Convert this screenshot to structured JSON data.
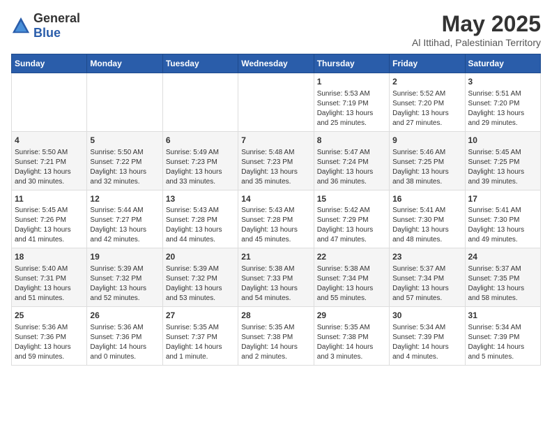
{
  "logo": {
    "text_general": "General",
    "text_blue": "Blue"
  },
  "title": "May 2025",
  "subtitle": "Al Ittihad, Palestinian Territory",
  "days_of_week": [
    "Sunday",
    "Monday",
    "Tuesday",
    "Wednesday",
    "Thursday",
    "Friday",
    "Saturday"
  ],
  "weeks": [
    [
      {
        "day": "",
        "info": ""
      },
      {
        "day": "",
        "info": ""
      },
      {
        "day": "",
        "info": ""
      },
      {
        "day": "",
        "info": ""
      },
      {
        "day": "1",
        "info": "Sunrise: 5:53 AM\nSunset: 7:19 PM\nDaylight: 13 hours\nand 25 minutes."
      },
      {
        "day": "2",
        "info": "Sunrise: 5:52 AM\nSunset: 7:20 PM\nDaylight: 13 hours\nand 27 minutes."
      },
      {
        "day": "3",
        "info": "Sunrise: 5:51 AM\nSunset: 7:20 PM\nDaylight: 13 hours\nand 29 minutes."
      }
    ],
    [
      {
        "day": "4",
        "info": "Sunrise: 5:50 AM\nSunset: 7:21 PM\nDaylight: 13 hours\nand 30 minutes."
      },
      {
        "day": "5",
        "info": "Sunrise: 5:50 AM\nSunset: 7:22 PM\nDaylight: 13 hours\nand 32 minutes."
      },
      {
        "day": "6",
        "info": "Sunrise: 5:49 AM\nSunset: 7:23 PM\nDaylight: 13 hours\nand 33 minutes."
      },
      {
        "day": "7",
        "info": "Sunrise: 5:48 AM\nSunset: 7:23 PM\nDaylight: 13 hours\nand 35 minutes."
      },
      {
        "day": "8",
        "info": "Sunrise: 5:47 AM\nSunset: 7:24 PM\nDaylight: 13 hours\nand 36 minutes."
      },
      {
        "day": "9",
        "info": "Sunrise: 5:46 AM\nSunset: 7:25 PM\nDaylight: 13 hours\nand 38 minutes."
      },
      {
        "day": "10",
        "info": "Sunrise: 5:45 AM\nSunset: 7:25 PM\nDaylight: 13 hours\nand 39 minutes."
      }
    ],
    [
      {
        "day": "11",
        "info": "Sunrise: 5:45 AM\nSunset: 7:26 PM\nDaylight: 13 hours\nand 41 minutes."
      },
      {
        "day": "12",
        "info": "Sunrise: 5:44 AM\nSunset: 7:27 PM\nDaylight: 13 hours\nand 42 minutes."
      },
      {
        "day": "13",
        "info": "Sunrise: 5:43 AM\nSunset: 7:28 PM\nDaylight: 13 hours\nand 44 minutes."
      },
      {
        "day": "14",
        "info": "Sunrise: 5:43 AM\nSunset: 7:28 PM\nDaylight: 13 hours\nand 45 minutes."
      },
      {
        "day": "15",
        "info": "Sunrise: 5:42 AM\nSunset: 7:29 PM\nDaylight: 13 hours\nand 47 minutes."
      },
      {
        "day": "16",
        "info": "Sunrise: 5:41 AM\nSunset: 7:30 PM\nDaylight: 13 hours\nand 48 minutes."
      },
      {
        "day": "17",
        "info": "Sunrise: 5:41 AM\nSunset: 7:30 PM\nDaylight: 13 hours\nand 49 minutes."
      }
    ],
    [
      {
        "day": "18",
        "info": "Sunrise: 5:40 AM\nSunset: 7:31 PM\nDaylight: 13 hours\nand 51 minutes."
      },
      {
        "day": "19",
        "info": "Sunrise: 5:39 AM\nSunset: 7:32 PM\nDaylight: 13 hours\nand 52 minutes."
      },
      {
        "day": "20",
        "info": "Sunrise: 5:39 AM\nSunset: 7:32 PM\nDaylight: 13 hours\nand 53 minutes."
      },
      {
        "day": "21",
        "info": "Sunrise: 5:38 AM\nSunset: 7:33 PM\nDaylight: 13 hours\nand 54 minutes."
      },
      {
        "day": "22",
        "info": "Sunrise: 5:38 AM\nSunset: 7:34 PM\nDaylight: 13 hours\nand 55 minutes."
      },
      {
        "day": "23",
        "info": "Sunrise: 5:37 AM\nSunset: 7:34 PM\nDaylight: 13 hours\nand 57 minutes."
      },
      {
        "day": "24",
        "info": "Sunrise: 5:37 AM\nSunset: 7:35 PM\nDaylight: 13 hours\nand 58 minutes."
      }
    ],
    [
      {
        "day": "25",
        "info": "Sunrise: 5:36 AM\nSunset: 7:36 PM\nDaylight: 13 hours\nand 59 minutes."
      },
      {
        "day": "26",
        "info": "Sunrise: 5:36 AM\nSunset: 7:36 PM\nDaylight: 14 hours\nand 0 minutes."
      },
      {
        "day": "27",
        "info": "Sunrise: 5:35 AM\nSunset: 7:37 PM\nDaylight: 14 hours\nand 1 minute."
      },
      {
        "day": "28",
        "info": "Sunrise: 5:35 AM\nSunset: 7:38 PM\nDaylight: 14 hours\nand 2 minutes."
      },
      {
        "day": "29",
        "info": "Sunrise: 5:35 AM\nSunset: 7:38 PM\nDaylight: 14 hours\nand 3 minutes."
      },
      {
        "day": "30",
        "info": "Sunrise: 5:34 AM\nSunset: 7:39 PM\nDaylight: 14 hours\nand 4 minutes."
      },
      {
        "day": "31",
        "info": "Sunrise: 5:34 AM\nSunset: 7:39 PM\nDaylight: 14 hours\nand 5 minutes."
      }
    ]
  ]
}
